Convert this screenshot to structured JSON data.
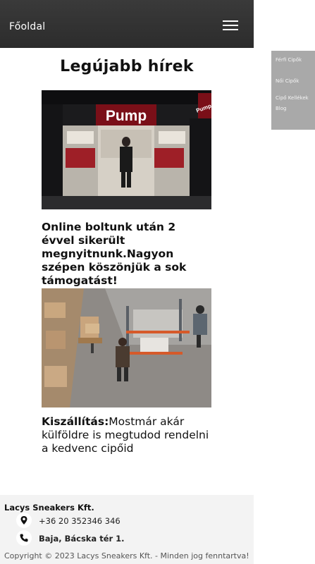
{
  "header": {
    "brand": "Főoldal",
    "menu_icon": "hamburger-menu-icon",
    "background": "#333333"
  },
  "side_menu": {
    "items": [
      "Férfi Cipők",
      "Női Cipők",
      "Cipő Kellékek",
      "Blog"
    ]
  },
  "main": {
    "title": "Legújabb hírek",
    "news": [
      {
        "image": "pump-store-photo",
        "image_sign": "Pump",
        "text": "Online boltunk után 2 évvel sikerült megnyitnunk.Nagyon szépen köszönjük a sok támogatást!"
      },
      {
        "image": "warehouse-photo",
        "lead": "Kiszállítás:",
        "text": "Mostmár akár külföldre is megtudod rendelni a kedvenc cipőid"
      }
    ]
  },
  "footer": {
    "company": "Lacys Sneakers Kft.",
    "phone": "+36 20 352346 346",
    "phone_icon": "phone-icon",
    "address": "Baja, Bácska tér 1.",
    "address_icon": "location-pin-icon",
    "copyright": "Copyright © 2023 Lacys Sneakers Kft. - Minden jog fenntartva!"
  }
}
